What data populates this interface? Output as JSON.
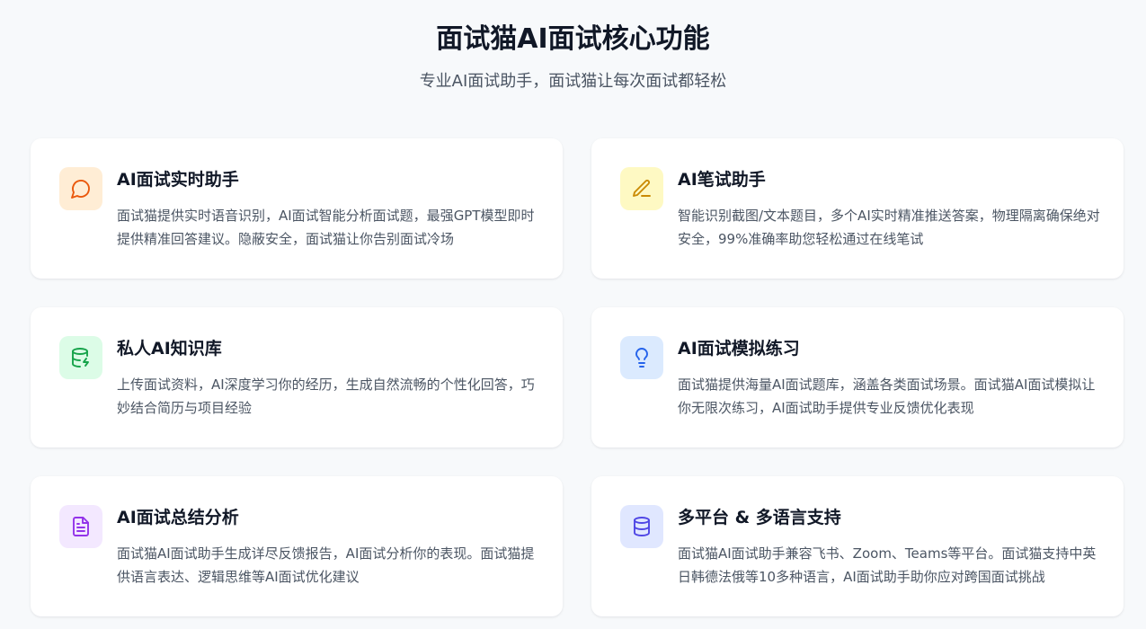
{
  "header": {
    "title": "面试猫AI面试核心功能",
    "subtitle": "专业AI面试助手，面试猫让每次面试都轻松"
  },
  "features": [
    {
      "title": "AI面试实时助手",
      "description": "面试猫提供实时语音识别，AI面试智能分析面试题，最强GPT模型即时提供精准回答建议。隐蔽安全，面试猫让你告别面试冷场",
      "icon": "chat-bubble-icon",
      "icon_bg": "#ffedd5",
      "icon_color": "#ea580c"
    },
    {
      "title": "AI笔试助手",
      "description": "智能识别截图/文本题目，多个AI实时精准推送答案，物理隔离确保绝对安全，99%准确率助您轻松通过在线笔试",
      "icon": "pencil-icon",
      "icon_bg": "#fef9c3",
      "icon_color": "#ca8a04"
    },
    {
      "title": "私人AI知识库",
      "description": "上传面试资料，AI深度学习你的经历，生成自然流畅的个性化回答，巧妙结合简历与项目经验",
      "icon": "database-bolt-icon",
      "icon_bg": "#dcfce7",
      "icon_color": "#16a34a"
    },
    {
      "title": "AI面试模拟练习",
      "description": "面试猫提供海量AI面试题库，涵盖各类面试场景。面试猫AI面试模拟让你无限次练习，AI面试助手提供专业反馈优化表现",
      "icon": "lightbulb-icon",
      "icon_bg": "#dbeafe",
      "icon_color": "#2563eb"
    },
    {
      "title": "AI面试总结分析",
      "description": "面试猫AI面试助手生成详尽反馈报告，AI面试分析你的表现。面试猫提供语言表达、逻辑思维等AI面试优化建议",
      "icon": "document-icon",
      "icon_bg": "#f3e8ff",
      "icon_color": "#9333ea"
    },
    {
      "title": "多平台 & 多语言支持",
      "description": "面试猫AI面试助手兼容飞书、Zoom、Teams等平台。面试猫支持中英日韩德法俄等10多种语言，AI面试助手助你应对跨国面试挑战",
      "icon": "database-icon",
      "icon_bg": "#e0e7ff",
      "icon_color": "#4f46e5"
    }
  ]
}
